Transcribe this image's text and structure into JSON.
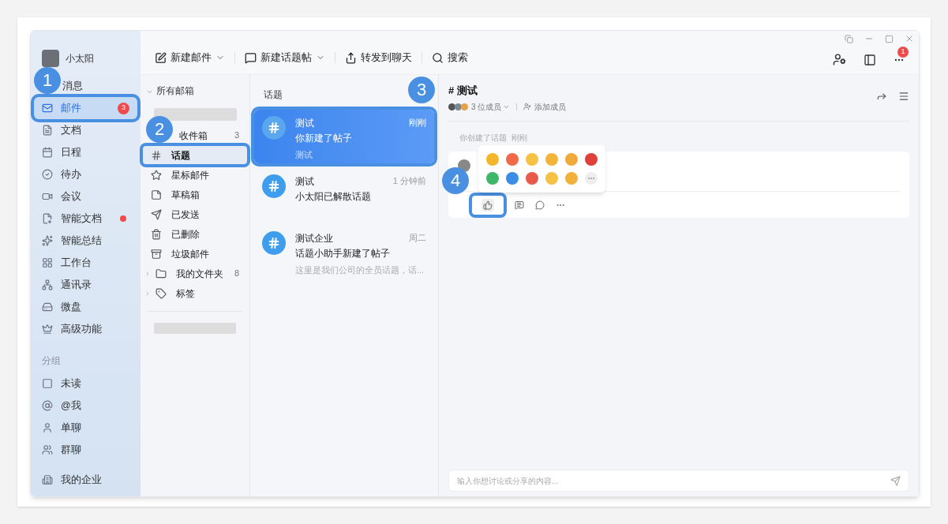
{
  "user": {
    "name": "小太阳"
  },
  "nav": [
    {
      "label": "消息",
      "selected": false,
      "callout": "1"
    },
    {
      "label": "邮件",
      "selected": true,
      "badge": "3"
    },
    {
      "label": "文档",
      "selected": false
    },
    {
      "label": "日程",
      "selected": false
    },
    {
      "label": "待办",
      "selected": false
    },
    {
      "label": "会议",
      "selected": false
    },
    {
      "label": "智能文档",
      "selected": false,
      "dot": true
    },
    {
      "label": "智能总结",
      "selected": false
    },
    {
      "label": "工作台",
      "selected": false
    },
    {
      "label": "通讯录",
      "selected": false
    },
    {
      "label": "微盘",
      "selected": false
    },
    {
      "label": "高级功能",
      "selected": false
    }
  ],
  "group_header": "分组",
  "groups": [
    {
      "label": "未读"
    },
    {
      "label": "@我"
    },
    {
      "label": "单聊"
    },
    {
      "label": "群聊"
    }
  ],
  "footer": {
    "label": "我的企业"
  },
  "toolbar": [
    {
      "label": "新建邮件",
      "dropdown": true
    },
    {
      "label": "新建话题帖",
      "dropdown": true
    },
    {
      "label": "转发到聊天",
      "dropdown": false
    },
    {
      "label": "搜索",
      "dropdown": false
    }
  ],
  "notification_badge": "1",
  "folders": {
    "header": "所有邮箱",
    "items": [
      {
        "label": "收件箱",
        "count": "3",
        "selected": false,
        "callout": "2"
      },
      {
        "label": "话题",
        "selected": true
      },
      {
        "label": "星标邮件",
        "selected": false
      },
      {
        "label": "草稿箱",
        "selected": false
      },
      {
        "label": "已发送",
        "selected": false
      },
      {
        "label": "已删除",
        "selected": false
      },
      {
        "label": "垃圾邮件",
        "selected": false
      },
      {
        "label": "我的文件夹",
        "count": "8",
        "selected": false,
        "expandable": true
      },
      {
        "label": "标签",
        "selected": false,
        "expandable": true
      }
    ]
  },
  "topics": {
    "header": "话题",
    "callout": "3",
    "items": [
      {
        "title": "测试",
        "time": "刚刚",
        "summary": "你新建了帖子",
        "preview": "测试",
        "selected": true
      },
      {
        "title": "测试",
        "time": "1 分钟前",
        "summary": "小太阳已解散话题",
        "selected": false
      },
      {
        "title": "测试企业",
        "time": "周二",
        "summary": "话题小助手新建了帖子",
        "preview": "这里是我们公司的全员话题，话...",
        "selected": false
      }
    ]
  },
  "detail": {
    "title": "# 测试",
    "members": "3 位成员",
    "add_member": "添加成员",
    "system_note": "你创建了话题",
    "system_time": "刚刚",
    "callout": "4",
    "composer_placeholder": "输入你想讨论或分享的内容..."
  }
}
